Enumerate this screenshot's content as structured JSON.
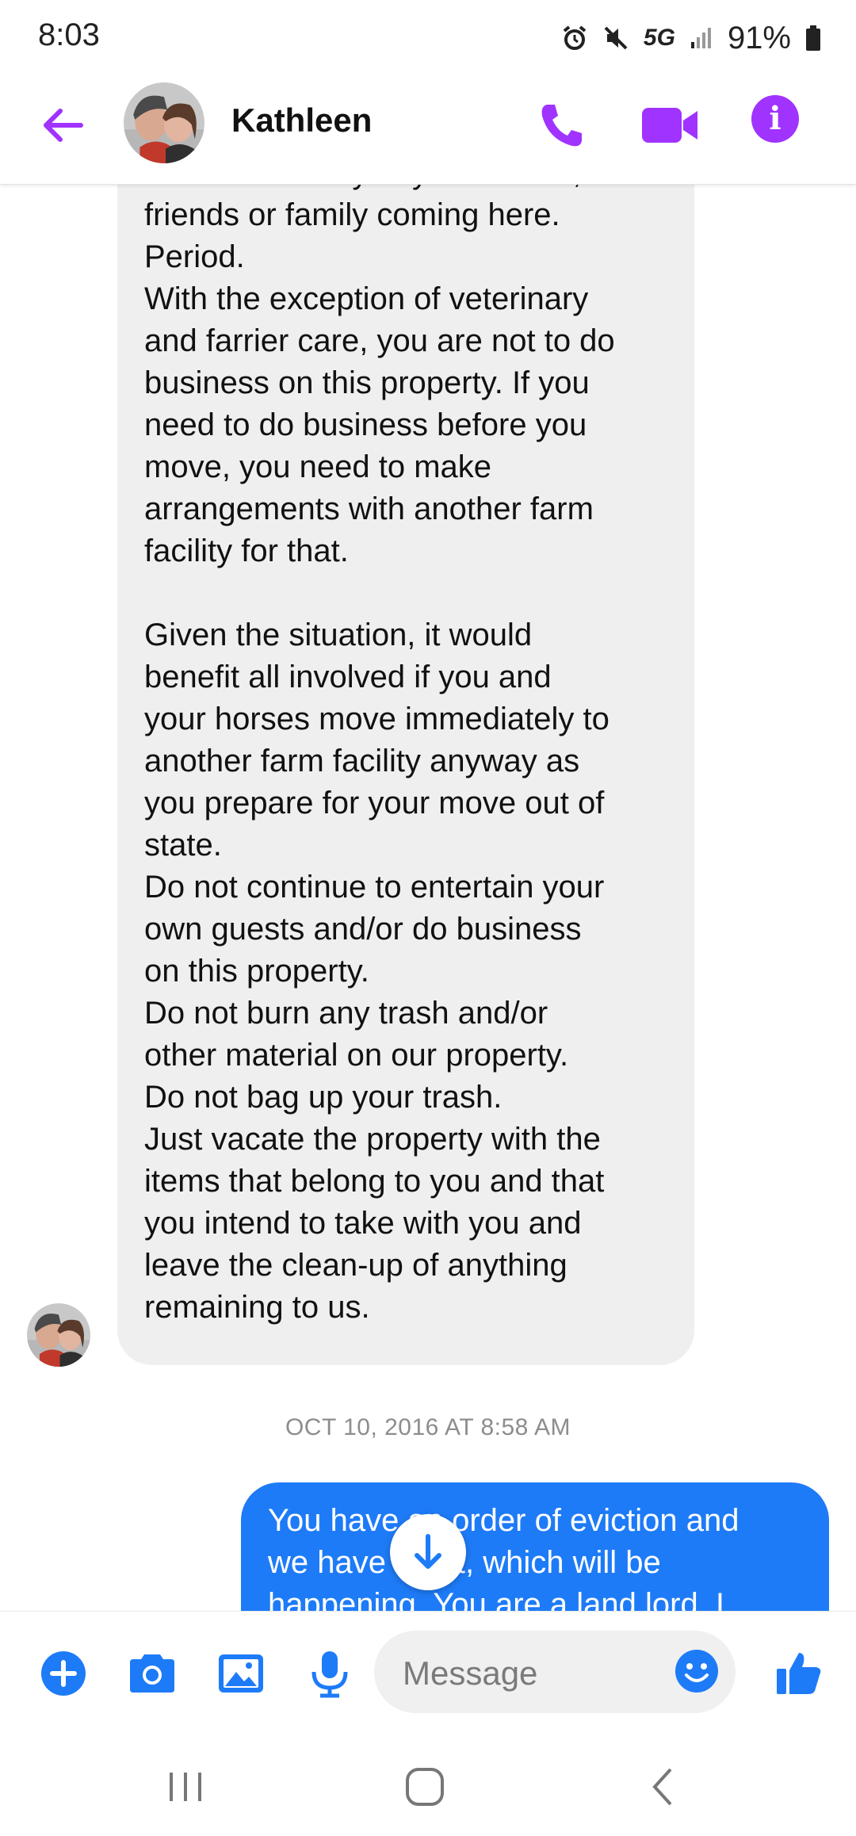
{
  "status_bar": {
    "time": "8:03",
    "network": "5G",
    "battery": "91%",
    "icons": [
      "alarm-icon",
      "mute-icon",
      "signal-icon",
      "battery-icon"
    ]
  },
  "header": {
    "contact_name": "Kathleen",
    "icons": [
      "back-arrow-icon",
      "phone-icon",
      "video-camera-icon",
      "info-icon"
    ],
    "accent_color": "#a033ff"
  },
  "messages": [
    {
      "direction": "incoming",
      "text": "do not want any of your clients,\nfriends or family coming here.\nPeriod.\nWith the exception of veterinary\nand farrier care, you are not to do\nbusiness on this property.   If you\nneed to do business before you\nmove, you need to make\narrangements with another farm\nfacility for that.\n\nGiven the situation, it would\nbenefit all involved if you and\nyour horses move immediately to\nanother farm facility anyway as\nyou prepare for your move out of\nstate.\nDo not continue to entertain your\nown guests and/or do business\non this property.\nDo not burn any trash and/or\nother material on our property.\nDo not bag up your trash.\nJust vacate the property with the\nitems that belong to you and that\nyou intend to take with you and\nleave the clean-up of anything\nremaining to us."
    },
    {
      "direction": "outgoing",
      "timestamp": "OCT 10, 2016 AT 8:58 AM",
      "text": "You have an order of eviction and\nwe have court, which will be\nhappening. You are a land lord. I"
    }
  ],
  "colors": {
    "incoming_bubble": "#efefef",
    "outgoing_bubble": "#1e7bf7",
    "composer_icons": "#1e7bf7"
  },
  "composer": {
    "placeholder": "Message",
    "icons": [
      "plus-icon",
      "camera-icon",
      "image-icon",
      "microphone-icon",
      "emoji-icon",
      "thumbs-up-icon"
    ]
  },
  "scroll_button": {
    "icon": "arrow-down-icon"
  },
  "nav_bar": {
    "icons": [
      "recent-apps-icon",
      "home-icon",
      "back-icon"
    ]
  }
}
